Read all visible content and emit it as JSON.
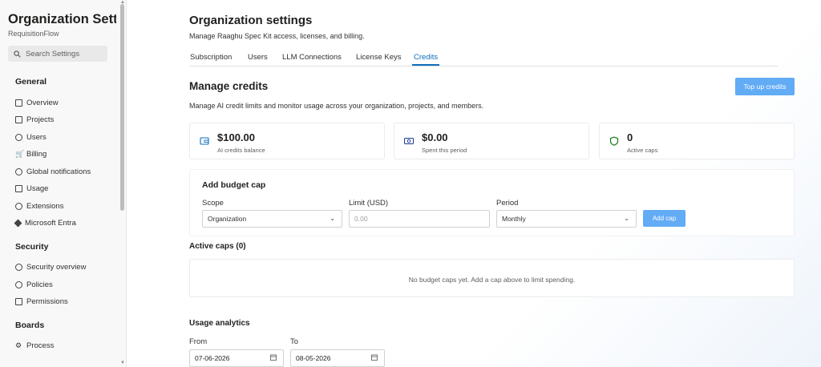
{
  "sidebar": {
    "title": "Organization Settin...",
    "subtitle": "RequisitionFlow",
    "search_placeholder": "Search Settings",
    "sections": [
      {
        "heading": "General",
        "items": [
          "Overview",
          "Projects",
          "Users",
          "Billing",
          "Global notifications",
          "Usage",
          "Extensions",
          "Microsoft Entra"
        ]
      },
      {
        "heading": "Security",
        "items": [
          "Security overview",
          "Policies",
          "Permissions"
        ]
      },
      {
        "heading": "Boards",
        "items": [
          "Process"
        ]
      }
    ]
  },
  "header": {
    "title": "Organization settings",
    "subtitle": "Manage Raaghu Spec Kit access, licenses, and billing."
  },
  "tabs": [
    "Subscription",
    "Users",
    "LLM Connections",
    "License Keys",
    "Credits"
  ],
  "active_tab": "Credits",
  "credits": {
    "title": "Manage credits",
    "topup_label": "Top up credits",
    "description": "Manage AI credit limits and monitor usage across your organization, projects, and members.",
    "stats": [
      {
        "value": "$100.00",
        "label": "AI credits balance",
        "icon": "wallet-icon"
      },
      {
        "value": "$0.00",
        "label": "Spent this period",
        "icon": "money-icon"
      },
      {
        "value": "0",
        "label": "Active caps",
        "icon": "shield-icon"
      }
    ]
  },
  "budget": {
    "title": "Add budget cap",
    "scope_label": "Scope",
    "scope_value": "Organization",
    "limit_label": "Limit (USD)",
    "limit_placeholder": "0.00",
    "period_label": "Period",
    "period_value": "Monthly",
    "add_label": "Add cap"
  },
  "active_caps": {
    "title": "Active caps (0)",
    "empty_text": "No budget caps yet. Add a cap above to limit spending."
  },
  "usage": {
    "title": "Usage analytics",
    "from_label": "From",
    "from_value": "07-06-2026",
    "to_label": "To",
    "to_value": "08-05-2026"
  },
  "colors": {
    "accent": "#0f6cbd",
    "button": "#62abf5",
    "shield": "#107c10"
  }
}
